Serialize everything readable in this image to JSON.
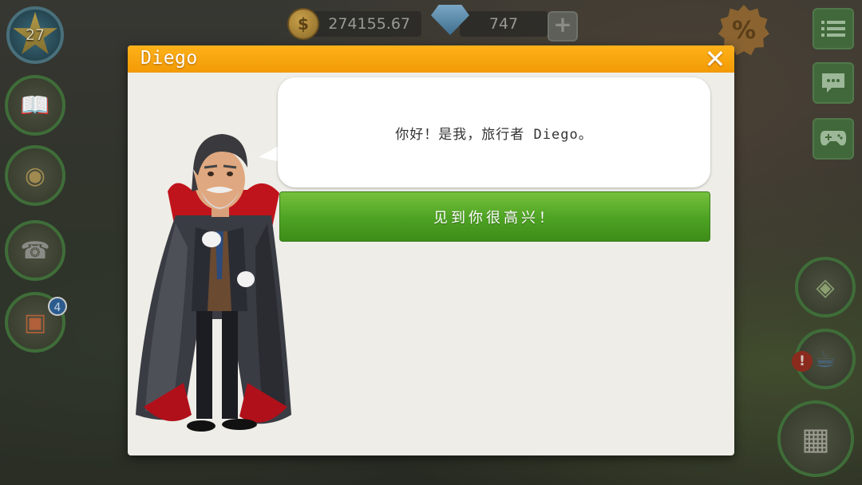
{
  "hud": {
    "level": "27",
    "coins": "274155.67",
    "gems": "747",
    "gem_plus": "+",
    "discount_symbol": "%"
  },
  "left_menu": {
    "gift_count": "4"
  },
  "right_menu": {
    "alert": "!"
  },
  "dialog": {
    "title": "Diego",
    "close_symbol": "✕",
    "speech": "你好！是我，旅行者 Diego。",
    "reply_button": "见到你很高兴！"
  },
  "colors": {
    "header_orange": "#f9a612",
    "button_green": "#4da223",
    "dialog_bg": "#eeede7"
  },
  "icons": [
    "star-level-icon",
    "coin-icon",
    "gem-icon",
    "percent-icon",
    "list-icon",
    "chat-icon",
    "gamepad-icon",
    "book-icon",
    "food-bag-icon",
    "phone-icon",
    "gift-icon",
    "map-icon",
    "coffee-icon",
    "cash-register-icon"
  ]
}
